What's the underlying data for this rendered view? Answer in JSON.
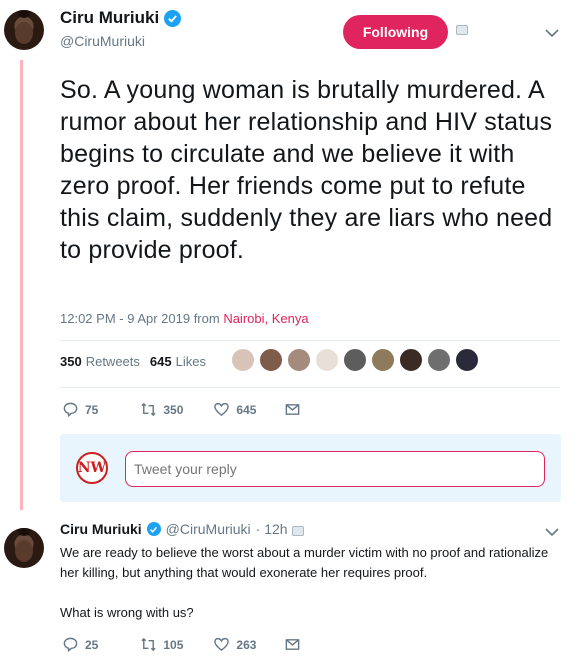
{
  "main_tweet": {
    "display_name": "Ciru Muriuki",
    "handle": "@CiruMuriuki",
    "follow_button": "Following",
    "text": "So. A young woman is brutally murdered. A rumor about her relationship and HIV status begins to circulate and we believe it with zero proof. Her friends come put to refute this claim, suddenly they are liars who need to provide proof.",
    "timestamp": "12:02 PM - 9 Apr 2019 from ",
    "location": "Nairobi, Kenya",
    "retweets_count": "350",
    "retweets_label": "Retweets",
    "likes_count": "645",
    "likes_label": "Likes",
    "actions": {
      "replies": "75",
      "retweets": "350",
      "likes": "645"
    }
  },
  "reply_box": {
    "avatar_text": "NW",
    "placeholder": "Tweet your reply"
  },
  "reply_tweet": {
    "display_name": "Ciru Muriuki",
    "handle": "@CiruMuriuki",
    "time": "· 12h",
    "text_p1": "We are ready to believe the worst about a murder victim with no proof and rationalize her killing, but anything that would exonerate her requires proof.",
    "text_p2": "What is wrong with us?",
    "actions": {
      "replies": "25",
      "retweets": "105",
      "likes": "263"
    }
  },
  "colors": {
    "accent": "#e0245e",
    "verified": "#1da1f2",
    "muted": "#657786",
    "thread_line": "#ffb3bd"
  },
  "icons": [
    "verified-icon",
    "caret-down-icon",
    "reply-icon",
    "retweet-icon",
    "like-icon",
    "message-icon"
  ]
}
